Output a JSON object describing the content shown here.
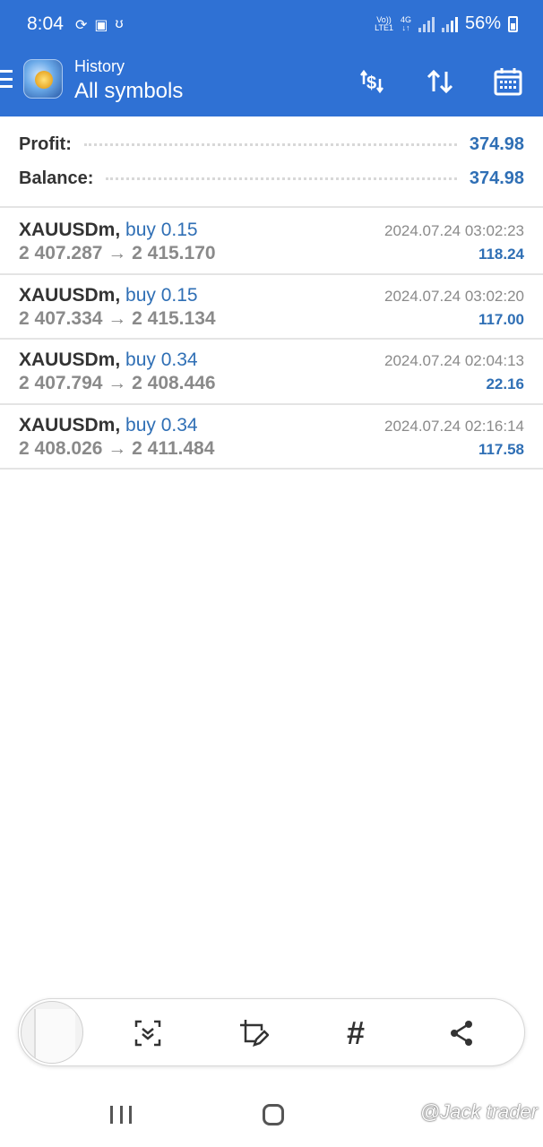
{
  "status_bar": {
    "time": "8:04",
    "network_top": "Vo))",
    "network_bottom": "LTE1",
    "network_type": "4G",
    "battery": "56%"
  },
  "app_bar": {
    "title_small": "History",
    "title_big": "All symbols",
    "icons": [
      "menu-icon",
      "currency-exchange-icon",
      "sort-arrows-icon",
      "calendar-icon"
    ]
  },
  "summary": {
    "profit_label": "Profit:",
    "profit_value": "374.98",
    "balance_label": "Balance:",
    "balance_value": "374.98"
  },
  "trades": [
    {
      "symbol": "XAUUSDm,",
      "side": "buy 0.15",
      "open": "2 407.287",
      "arrow": "→",
      "close": "2 415.170",
      "time": "2024.07.24 03:02:23",
      "profit": "118.24"
    },
    {
      "symbol": "XAUUSDm,",
      "side": "buy 0.15",
      "open": "2 407.334",
      "arrow": "→",
      "close": "2 415.134",
      "time": "2024.07.24 03:02:20",
      "profit": "117.00"
    },
    {
      "symbol": "XAUUSDm,",
      "side": "buy 0.34",
      "open": "2 407.794",
      "arrow": "→",
      "close": "2 408.446",
      "time": "2024.07.24 02:04:13",
      "profit": "22.16"
    },
    {
      "symbol": "XAUUSDm,",
      "side": "buy 0.34",
      "open": "2 408.026",
      "arrow": "→",
      "close": "2 411.484",
      "time": "2024.07.24 02:16:14",
      "profit": "117.58"
    }
  ],
  "toolbar": {
    "hash": "#",
    "icons": [
      "expand-capture-icon",
      "crop-edit-icon",
      "hashtag-icon",
      "share-icon"
    ]
  },
  "watermark": "@Jack trader",
  "colors": {
    "primary": "#2f71d4",
    "value_blue": "#2f6fb5",
    "muted": "#8a8a8a"
  }
}
